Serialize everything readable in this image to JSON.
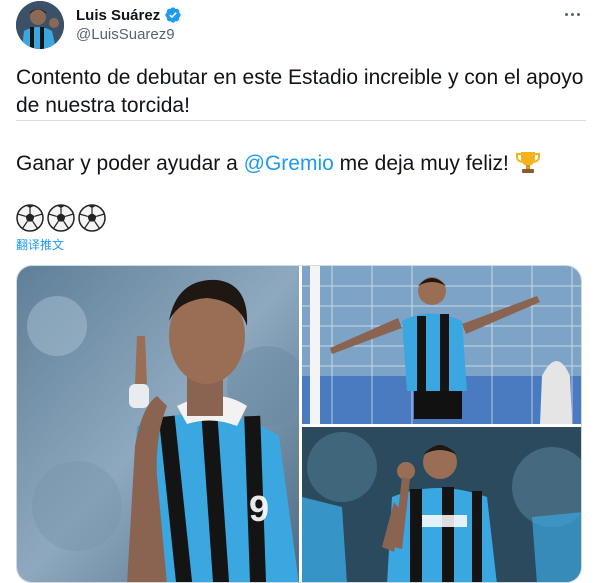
{
  "author": {
    "name": "Luis Suárez",
    "handle": "@LuisSuarez9",
    "verified": true,
    "avatar_icon": "avatar-photo"
  },
  "tweet": {
    "line1": "Contento de debutar en este Estadio increible y con el apoyo de nuestra torcida!",
    "line1_emoji": "estonia-flag-icon",
    "line2_before": "Ganar y poder ayudar a ",
    "mention": "@Gremio",
    "line2_after": " me deja muy feliz!",
    "line2_emoji": "trophy-icon",
    "line3_emoji": [
      "soccer-ball-icon",
      "soccer-ball-icon",
      "soccer-ball-icon"
    ],
    "translate_label": "翻译推文"
  },
  "media": {
    "photos": [
      "photo-celebration-kiss",
      "photo-arms-wide",
      "photo-fist-pump"
    ]
  },
  "colors": {
    "link": "#1d9bf0",
    "text": "#0f1419",
    "secondary": "#536471",
    "jersey_blue": "#3aa7e0",
    "jersey_black": "#141414"
  }
}
